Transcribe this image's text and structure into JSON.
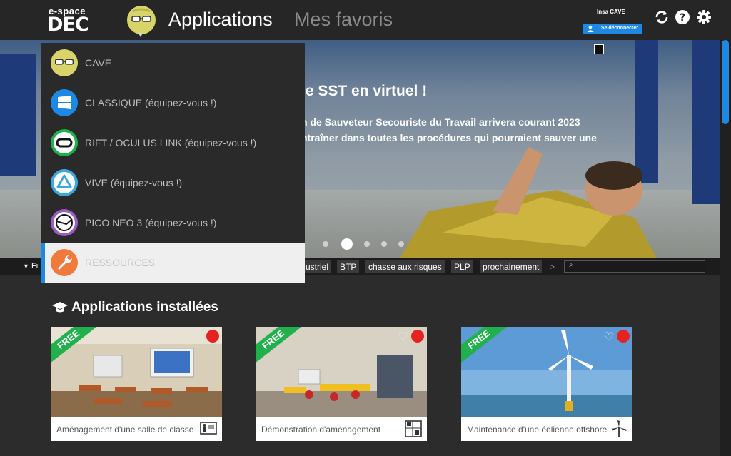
{
  "brand": {
    "line1": "e-space",
    "line2": "DEC"
  },
  "nav": {
    "apps": "Applications",
    "favorites": "Mes favoris"
  },
  "user": {
    "name": "Insa CAVE",
    "logout": "Se déconnecter"
  },
  "toolbar_icons": [
    "refresh-icon",
    "help-icon",
    "settings-icon"
  ],
  "dropdown": {
    "items": [
      {
        "label": "CAVE",
        "icon": "cave-head-icon",
        "color": "#d8d46a"
      },
      {
        "label": "CLASSIQUE (équipez-vous !)",
        "icon": "windows-icon",
        "color": "#1e88e5"
      },
      {
        "label": "RIFT / OCULUS LINK (équipez-vous !)",
        "icon": "oculus-icon",
        "color": "#20b14c"
      },
      {
        "label": "VIVE (équipez-vous !)",
        "icon": "vive-icon",
        "color": "#3da8e0"
      },
      {
        "label": "PICO NEO 3 (équipez-vous !)",
        "icon": "pico-icon",
        "color": "#9c5cc8"
      },
      {
        "label": "RESSOURCES",
        "icon": "wrench-icon",
        "color": "#f07a3c",
        "selected": true
      }
    ]
  },
  "banner": {
    "title": "le SST en virtuel !",
    "line1_prefix": "n de Sauveteur Secouriste du Travail arrivera ",
    "line1_bold": "courant 2023",
    "line2": "ntraîner dans toutes les procédures qui pourraient sauver une",
    "active_slide": 1,
    "slide_count": 5
  },
  "filters": {
    "label": "Fi",
    "tags": [
      "ustriel",
      "BTP",
      "chasse aux risques",
      "PLP",
      "prochainement"
    ],
    "more": ">",
    "search_placeholder": ""
  },
  "section": {
    "title": "Applications installées"
  },
  "cards": [
    {
      "badge": "FREE",
      "caption": "Aménagement d'une salle de classe",
      "icon": "classroom-board-icon",
      "favorite": false
    },
    {
      "badge": "FREE",
      "caption": "Démonstration d'aménagement",
      "icon": "floorplan-icon",
      "favorite": true
    },
    {
      "badge": "FREE",
      "caption": "Maintenance d'une éolienne offshore",
      "icon": "wind-turbine-icon",
      "favorite": true
    }
  ]
}
